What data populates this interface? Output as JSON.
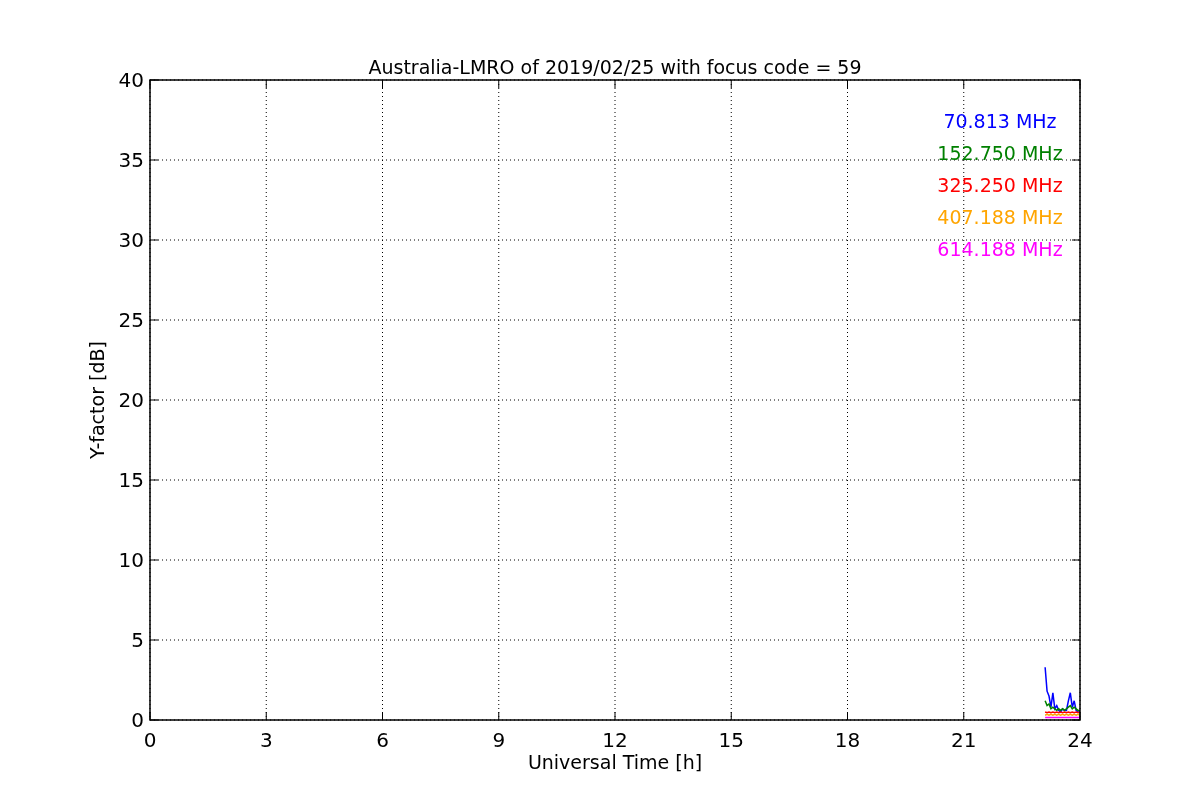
{
  "chart_data": {
    "type": "line",
    "title": "Australia-LMRO of 2019/02/25 with focus code = 59",
    "xlabel": "Universal Time [h]",
    "ylabel": "Y-factor [dB]",
    "x": [
      23.1,
      23.15,
      23.2,
      23.25,
      23.3,
      23.35,
      23.4,
      23.45,
      23.5,
      23.55,
      23.6,
      23.65,
      23.7,
      23.75,
      23.8,
      23.85,
      23.9,
      23.95,
      24.0
    ],
    "series": [
      {
        "name": "70.813 MHz",
        "color": "#0000ff",
        "values": [
          3.3,
          1.8,
          1.5,
          0.8,
          1.7,
          0.7,
          0.9,
          0.6,
          0.5,
          0.7,
          0.6,
          0.6,
          1.2,
          1.7,
          0.8,
          1.2,
          0.6,
          0.5,
          0.5
        ]
      },
      {
        "name": "152.750 MHz",
        "color": "#008000",
        "values": [
          1.2,
          0.9,
          1.0,
          0.7,
          0.8,
          0.7,
          0.6,
          0.7,
          0.6,
          0.7,
          0.6,
          0.7,
          0.8,
          0.9,
          0.7,
          0.8,
          0.7,
          0.6,
          0.6
        ]
      },
      {
        "name": "325.250 MHz",
        "color": "#ff0000",
        "values": [
          0.5,
          0.45,
          0.5,
          0.45,
          0.5,
          0.45,
          0.5,
          0.45,
          0.5,
          0.45,
          0.5,
          0.45,
          0.5,
          0.45,
          0.5,
          0.45,
          0.5,
          0.45,
          0.5
        ]
      },
      {
        "name": "407.188 MHz",
        "color": "#ffa500",
        "values": [
          0.3,
          0.35,
          0.3,
          0.35,
          0.3,
          0.35,
          0.3,
          0.35,
          0.3,
          0.35,
          0.3,
          0.35,
          0.3,
          0.35,
          0.3,
          0.35,
          0.3,
          0.35,
          0.3
        ]
      },
      {
        "name": "614.188 MHz",
        "color": "#ff00ff",
        "values": [
          0.15,
          0.15,
          0.15,
          0.15,
          0.15,
          0.15,
          0.15,
          0.15,
          0.15,
          0.15,
          0.15,
          0.15,
          0.15,
          0.15,
          0.15,
          0.15,
          0.15,
          0.15,
          0.15
        ]
      }
    ],
    "xlim": [
      0,
      24
    ],
    "ylim": [
      0,
      40
    ],
    "grid": true,
    "xticks": [
      0,
      3,
      6,
      9,
      12,
      15,
      18,
      21,
      24
    ],
    "yticks": [
      0,
      5,
      10,
      15,
      20,
      25,
      30,
      35,
      40
    ]
  }
}
